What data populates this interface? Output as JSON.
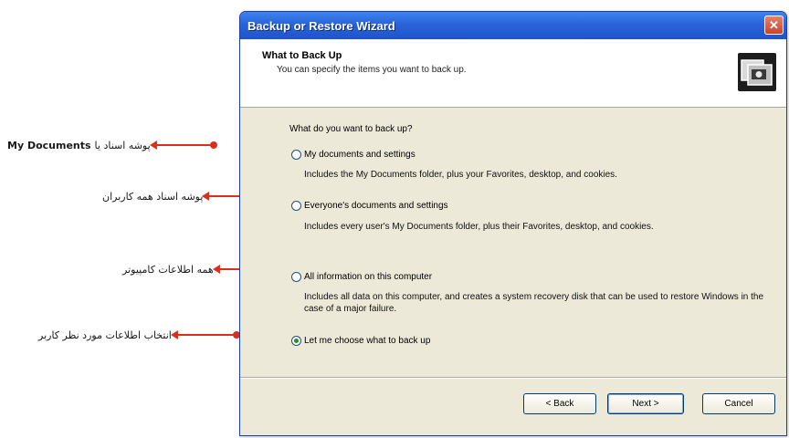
{
  "annotations": [
    {
      "text_fa": "پوشه اسناد یا",
      "text_en": "My Documents"
    },
    {
      "text_fa": "پوشه اسناد همه کاربران"
    },
    {
      "text_fa": "همه اطلاعات کامپیوتر"
    },
    {
      "text_fa": "انتخاب اطلاعات مورد نظر کاربر"
    }
  ],
  "window": {
    "title": "Backup or Restore Wizard",
    "close_label": "✕"
  },
  "header": {
    "title": "What to Back Up",
    "subtitle": "You can specify the items you want to back up.",
    "icon": "backup-wizard-icon"
  },
  "content": {
    "question": "What do you want to back up?",
    "options": [
      {
        "label": "My documents and settings",
        "description": "Includes the My Documents folder, plus your Favorites, desktop, and cookies.",
        "selected": false
      },
      {
        "label": "Everyone's documents and settings",
        "description": "Includes every user's My Documents folder, plus their Favorites, desktop, and cookies.",
        "selected": false
      },
      {
        "label": "All information on this computer",
        "description": "Includes all data on this computer, and creates a system recovery disk that can be used to restore Windows in the case of a major failure.",
        "selected": false
      },
      {
        "label": "Let me choose what to back up",
        "selected": true
      }
    ]
  },
  "buttons": {
    "back": "< Back",
    "next": "Next >",
    "cancel": "Cancel"
  },
  "colors": {
    "arrow": "#d9301e",
    "titlebar": "#2a63d8",
    "dialog_bg": "#ece9d8"
  }
}
